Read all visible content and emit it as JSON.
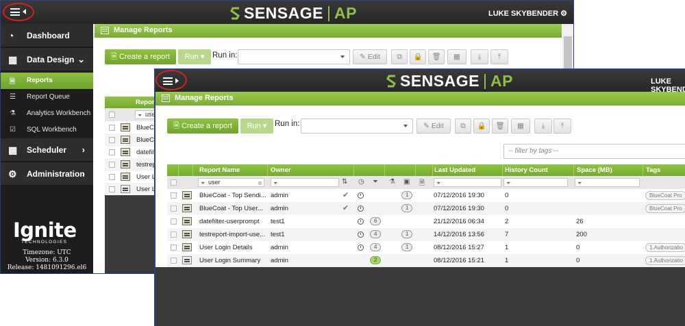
{
  "brand": {
    "name": "SENSAGE",
    "suffix": "AP"
  },
  "user": {
    "name": "LUKE SKYBENDER"
  },
  "back_window": {
    "sidebar": {
      "items": [
        {
          "label": "Dashboard"
        },
        {
          "label": "Data Design"
        },
        {
          "label": "Scheduler"
        },
        {
          "label": "Administration"
        }
      ],
      "sub_items": [
        {
          "label": "Reports"
        },
        {
          "label": "Report Queue"
        },
        {
          "label": "Analytics Workbench"
        },
        {
          "label": "SQL Workbench"
        }
      ],
      "company": "Ignite",
      "company_sub": "TECHNOLOGIES",
      "timezone": "Timezone: UTC",
      "version": "Version: 6.3.0",
      "release": "Release: 1481091296.el6"
    },
    "panel_title": "Manage Reports",
    "create_label": "Create a report",
    "run_label": "Run",
    "run_in_label": "Run in:",
    "edit_label": "Edit",
    "col_partial": "Report",
    "filter_partial": "use",
    "rows": [
      "BlueCo",
      "BlueCo",
      "datefilt",
      "testrepo",
      "User Lo",
      "User Lo"
    ]
  },
  "front_window": {
    "panel_title": "Manage Reports",
    "create_label": "Create a report",
    "run_label": "Run",
    "run_in_label": "Run in:",
    "edit_label": "Edit",
    "tag_filter_placeholder": "-- filter by tags --",
    "columns": {
      "name": "Report Name",
      "owner": "Owner",
      "last_updated": "Last Updated",
      "history": "History Count",
      "space": "Space (MB)",
      "tags": "Tags"
    },
    "name_filter": "user",
    "rows": [
      {
        "name": "BlueCoat - Top Sendi...",
        "owner": "admin",
        "check": true,
        "clock": true,
        "pill": "",
        "pill2": "1",
        "updated": "07/12/2016 19:30",
        "history": "0",
        "space": "",
        "tag": "BlueCoat Pro"
      },
      {
        "name": "BlueCoat - Top User...",
        "owner": "admin",
        "check": true,
        "clock": true,
        "pill": "",
        "pill2": "1",
        "updated": "07/12/2016 19:30",
        "history": "0",
        "space": "",
        "tag": "BlueCoat Pro"
      },
      {
        "name": "datefilter-userprompt",
        "owner": "test1",
        "check": false,
        "clock": true,
        "pill": "6",
        "pill2": "",
        "updated": "21/12/2016 06:34",
        "history": "2",
        "space": "26",
        "tag": ""
      },
      {
        "name": "testreport-import-use...",
        "owner": "test1",
        "check": false,
        "clock": true,
        "pill": "4",
        "pill2": "1",
        "updated": "14/12/2016 13:56",
        "history": "7",
        "space": "200",
        "tag": ""
      },
      {
        "name": "User Login Details",
        "owner": "admin",
        "check": false,
        "clock": true,
        "pill": "4",
        "pill2": "1",
        "updated": "08/12/2016 15:27",
        "history": "1",
        "space": "0",
        "tag": "1.Authorizatio"
      },
      {
        "name": "User Login Summary",
        "owner": "admin",
        "check": false,
        "clock": false,
        "pill": "2",
        "pill2": "",
        "updated": "08/12/2016 15:21",
        "history": "1",
        "space": "0",
        "tag": "1.Authorizatio"
      }
    ]
  },
  "colors": {
    "accent_green": "#7cb135",
    "topbar": "#2b2b2b",
    "highlight_ring": "#d8221e"
  }
}
